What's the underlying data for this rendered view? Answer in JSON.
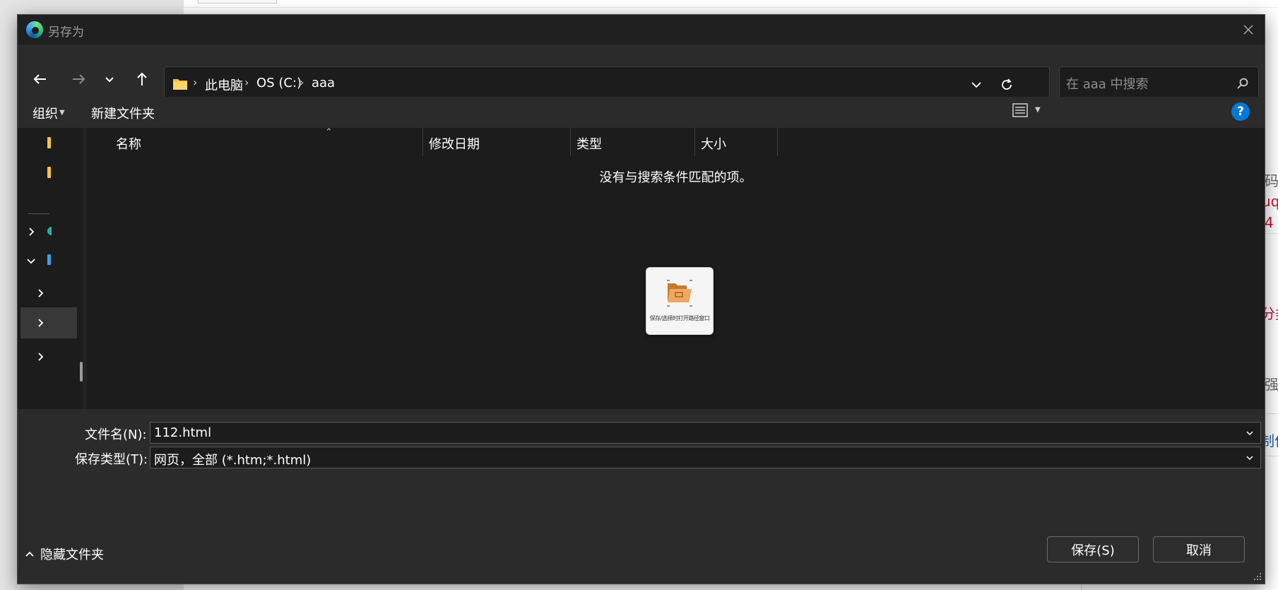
{
  "window": {
    "title": "另存为"
  },
  "navigation": {
    "back_icon": "arrow-left-icon",
    "forward_icon": "arrow-right-icon",
    "recent_icon": "chevron-down-icon",
    "up_icon": "arrow-up-icon",
    "breadcrumb": [
      "此电脑",
      "OS (C:)",
      "aaa"
    ],
    "refresh_icon": "refresh-icon"
  },
  "search": {
    "placeholder": "在 aaa 中搜索",
    "value": ""
  },
  "toolbar": {
    "organize_label": "组织",
    "new_folder_label": "新建文件夹",
    "help_label": "?"
  },
  "columns": [
    "名称",
    "修改日期",
    "类型",
    "大小"
  ],
  "empty_message": "没有与搜索条件匹配的项。",
  "floating_card": {
    "caption": "保存/选择时打开路径窗口",
    "icon": "folder-open-icon"
  },
  "footer": {
    "filename_label": "文件名(N):",
    "filename_value": "112.html",
    "filetype_label": "保存类型(T):",
    "filetype_value": "网页，全部 (*.htm;*.html)",
    "hide_folders_label": "隐藏文件夹",
    "save_label": "保存(S)",
    "cancel_label": "取消"
  },
  "background_page": {
    "fragments": [
      "码",
      "uq",
      "4",
      "分类",
      "强",
      "制作"
    ]
  },
  "colors": {
    "accent": "#0078d4",
    "dialog_bg": "#1c1c1c",
    "panel_bg": "#2b2b2b",
    "folder_yellow": "#f4c542"
  }
}
